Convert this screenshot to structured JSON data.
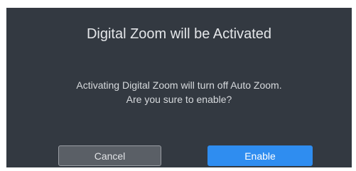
{
  "dialog": {
    "title": "Digital Zoom will be Activated",
    "message_line1": "Activating Digital Zoom will turn off Auto Zoom.",
    "message_line2": "Are you sure to enable?",
    "cancel_label": "Cancel",
    "enable_label": "Enable"
  },
  "colors": {
    "dialog_background": "#333941",
    "enable_button": "#2f8df0",
    "cancel_button": "#5a5f66"
  }
}
